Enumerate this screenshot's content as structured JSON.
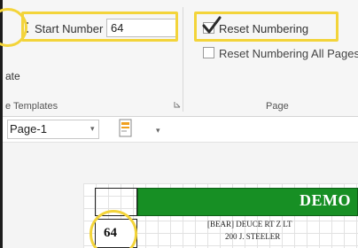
{
  "window": {
    "frame": "left-edge"
  },
  "page_numbering": {
    "start_number_label": "Start Number",
    "start_number_value": "64",
    "reset_numbering_label": "Reset Numbering",
    "reset_numbering_checked": true,
    "reset_all_pages_label": "Reset Numbering All Pages",
    "reset_all_pages_checked": false
  },
  "ribbon": {
    "date_label": "ate",
    "templates_group_label": "e Templates",
    "page_group_label": "Page",
    "template_select_value": "Page-1"
  },
  "document": {
    "header_title": "DEMO",
    "page_number": "64",
    "detail_line1": "[BEAR] DEUCE RT Z LT",
    "detail_line2": "200 J. STEELER"
  },
  "colors": {
    "highlight": "#f3d43a",
    "band_green": "#178f24",
    "ribbon_bg": "#f6f6f6"
  },
  "icons": {
    "start_number": "bracket-icon",
    "reset_check": "checkmark-icon",
    "group_launcher": "dialog-launcher-icon",
    "template": "page-template-icon",
    "dropdown": "chevron-down-icon"
  }
}
